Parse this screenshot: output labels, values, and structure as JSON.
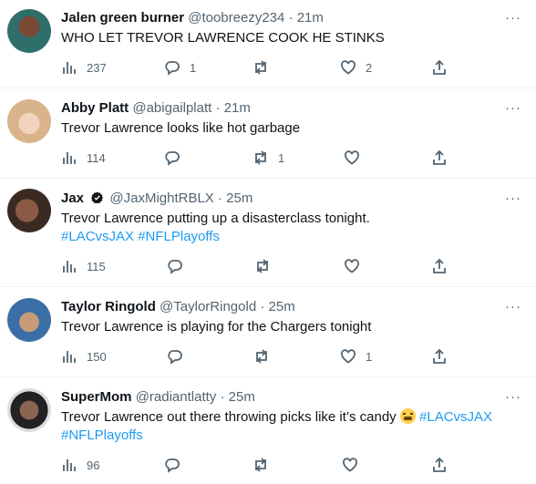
{
  "tweets": [
    {
      "name": "Jalen green burner",
      "handle": "@toobreezy234",
      "dot": "·",
      "time": "21m",
      "text": "WHO LET TREVOR LAWRENCE COOK HE STINKS",
      "views": "237",
      "replies": "1",
      "retweets": "",
      "likes": "2",
      "avatar_color": "#2f6f6b"
    },
    {
      "name": "Abby Platt",
      "handle": "@abigailplatt",
      "dot": "·",
      "time": "21m",
      "text": "Trevor Lawrence looks like hot garbage",
      "views": "114",
      "replies": "",
      "retweets": "1",
      "likes": "",
      "avatar_color": "#d9b48a"
    },
    {
      "name": "Jax",
      "verified_icon": "verified-badge-icon",
      "handle": "@JaxMightRBLX",
      "dot": "·",
      "time": "25m",
      "text": "Trevor Lawrence putting up a disasterclass tonight.",
      "hashtags": "#LACvsJAX #NFLPlayoffs",
      "views": "115",
      "replies": "",
      "retweets": "",
      "likes": "",
      "avatar_color": "#5a3b2e"
    },
    {
      "name": "Taylor Ringold",
      "handle": "@TaylorRingold",
      "dot": "·",
      "time": "25m",
      "text": "Trevor Lawrence is playing for the Chargers tonight",
      "views": "150",
      "replies": "",
      "retweets": "",
      "likes": "1",
      "avatar_color": "#3a6ea5"
    },
    {
      "name": "SuperMom",
      "handle": "@radiantlatty",
      "dot": "·",
      "time": "25m",
      "text": "Trevor Lawrence out there throwing picks like it’s candy",
      "emoji": "tired-face-emoji",
      "hashtags_inline": "#LACvsJAX",
      "hashtags": "#NFLPlayoffs",
      "views": "96",
      "replies": "",
      "retweets": "",
      "likes": "",
      "avatar_color": "#4a4a4a"
    }
  ],
  "more_label": "···",
  "colors": {
    "accent": "#1d9bf0",
    "secondary_text": "#536471",
    "divider": "#eff3f4"
  }
}
